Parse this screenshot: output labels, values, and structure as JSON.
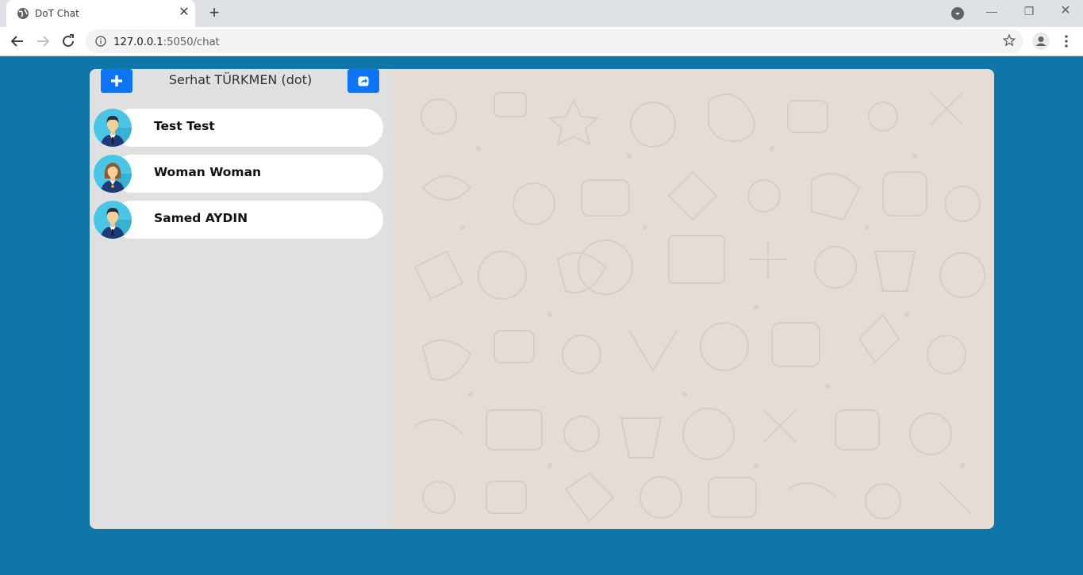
{
  "browser": {
    "tab_title": "DoT Chat",
    "url_host": "127.0.0.1",
    "url_rest": ":5050/chat"
  },
  "app": {
    "current_user": "Serhat TÜRKMEN (dot)",
    "contacts": [
      {
        "name": "Test Test",
        "avatar": "male-avatar-icon"
      },
      {
        "name": "Woman Woman",
        "avatar": "female-avatar-icon"
      },
      {
        "name": "Samed AYDIN",
        "avatar": "male-avatar-icon"
      }
    ]
  },
  "colors": {
    "page_bg": "#1075a8",
    "accent_button": "#0d74f5",
    "sidebar_bg": "#e0e0e0",
    "chat_bg": "#e5ddd5"
  }
}
